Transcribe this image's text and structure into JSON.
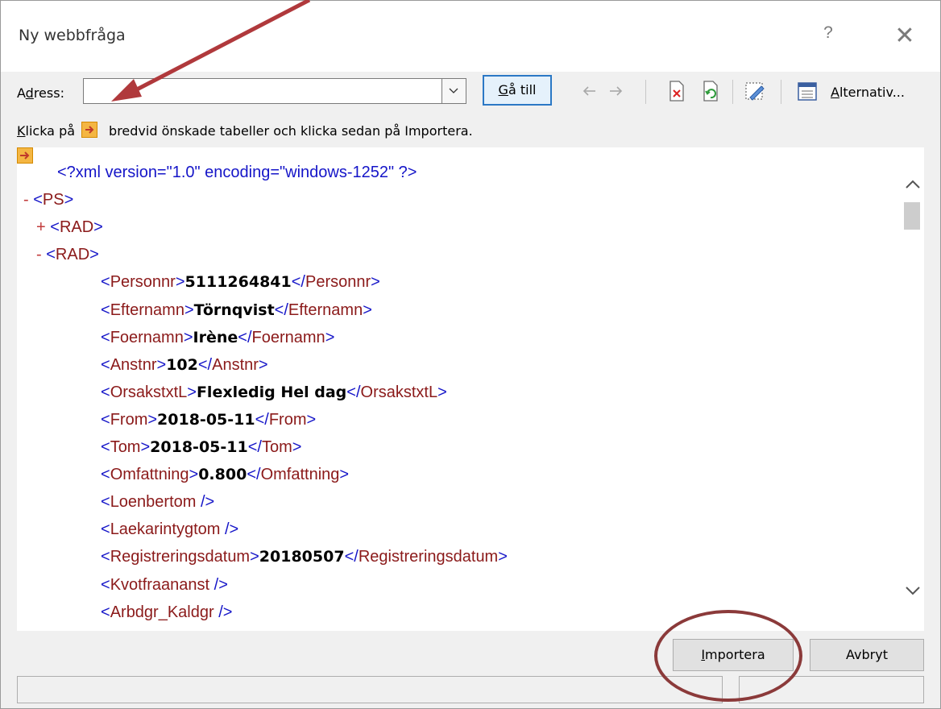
{
  "window": {
    "title": "Ny webbfråga",
    "help_glyph": "?",
    "close_glyph": "✕"
  },
  "toolbar": {
    "address_label_pre": "A",
    "address_label_ul": "d",
    "address_label_post": "ress:",
    "address_value": "",
    "goto_ul": "G",
    "goto_rest": "å till",
    "alternatives_ul": "A",
    "alternatives_rest": "lternativ...",
    "icons": [
      "back-arrow-icon",
      "forward-arrow-icon",
      "stop-icon",
      "refresh-icon",
      "no-icons-icon",
      "options-icon"
    ]
  },
  "hint": {
    "pre_ul": "K",
    "pre": "licka på",
    "post": "bredvid önskade tabeller och klicka sedan på Importera."
  },
  "xml_lines": [
    {
      "kind": "decl",
      "text": "<?xml version=\"1.0\" encoding=\"windows-1252\" ?>"
    },
    {
      "kind": "open",
      "sign": "-",
      "text": "<PS>"
    },
    {
      "kind": "open",
      "sign": "+",
      "text": "<RAD>"
    },
    {
      "kind": "open",
      "sign": "-",
      "text": "<RAD>"
    },
    {
      "kind": "el",
      "tag": "Personnr",
      "value": "5111264841"
    },
    {
      "kind": "el",
      "tag": "Efternamn",
      "value": "Törnqvist"
    },
    {
      "kind": "el",
      "tag": "Foernamn",
      "value": "Irène"
    },
    {
      "kind": "el",
      "tag": "Anstnr",
      "value": "102"
    },
    {
      "kind": "el",
      "tag": "OrsakstxtL",
      "value": "Flexledig Hel dag"
    },
    {
      "kind": "el",
      "tag": "From",
      "value": "2018-05-11"
    },
    {
      "kind": "el",
      "tag": "Tom",
      "value": "2018-05-11"
    },
    {
      "kind": "el",
      "tag": "Omfattning",
      "value": "0.800"
    },
    {
      "kind": "empty",
      "tag": "Loenbertom"
    },
    {
      "kind": "empty",
      "tag": "Laekarintygtom"
    },
    {
      "kind": "el",
      "tag": "Registreringsdatum",
      "value": "20180507"
    },
    {
      "kind": "empty",
      "tag": "Kvotfraananst"
    },
    {
      "kind": "empty",
      "tag": "Arbdgr_Kaldgr"
    }
  ],
  "buttons": {
    "import_ul": "I",
    "import_rest": "mportera",
    "cancel": "Avbryt"
  },
  "colors": {
    "annotation": "#b0393c",
    "goto_border": "#2b78c5",
    "tag_blue": "#1515c8",
    "tag_red": "#8b1a1a"
  }
}
